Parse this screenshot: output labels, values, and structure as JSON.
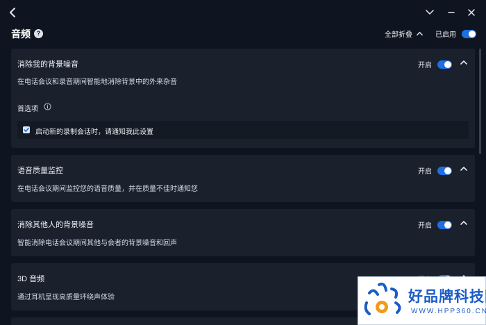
{
  "header": {
    "title": "音频",
    "help_glyph": "?",
    "collapse_all_label": "全部折叠",
    "enabled_label": "已启用",
    "master_enabled": true
  },
  "sections": [
    {
      "title": "消除我的背景噪音",
      "description": "在电话会议和录音期间智能地消除背景中的外来杂音",
      "switch_label": "开启",
      "enabled": true,
      "preferences_label": "首选项",
      "preference_option": {
        "label": "启动新的录制会话时，请通知我此设置",
        "checked": true
      }
    },
    {
      "title": "语音质量监控",
      "description": "在电话会议期间监控您的语音质量，并在质量不佳时通知您",
      "switch_label": "开启",
      "enabled": true
    },
    {
      "title": "消除其他人的背景噪音",
      "description": "智能消除电话会议期间其他与会者的背景噪音和回声",
      "switch_label": "开启",
      "enabled": true
    },
    {
      "title": "3D 音频",
      "description": "通过耳机呈现高质量环绕声体验",
      "switch_label": "开启",
      "enabled": true
    }
  ],
  "watermark": {
    "brand": "好品牌科技网",
    "url": "WWW.HPP360.CN"
  },
  "colors": {
    "background": "#0f1520",
    "card": "#1a212d",
    "accent": "#1f6fe0",
    "watermark_blue": "#1a5cc8"
  },
  "icons": [
    "back-arrow-icon",
    "chevron-down-icon",
    "minimize-icon",
    "close-icon",
    "help-icon",
    "chevron-up-icon",
    "info-icon",
    "checkmark-icon"
  ]
}
